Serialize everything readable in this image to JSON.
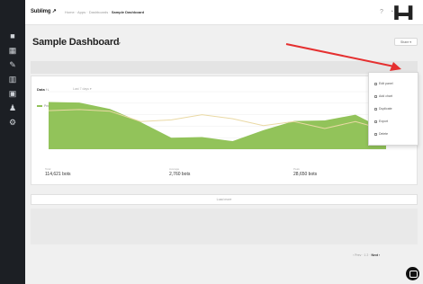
{
  "app": {
    "logo": "Sublimg ↗"
  },
  "breadcrumb": {
    "items": [
      "Home",
      "Apps",
      "Dashboards"
    ],
    "current": "Sample Dashboard"
  },
  "header": {
    "title": "Sample Dashboard",
    "share_label": "Share ▾"
  },
  "panel": {
    "title": "Data ↑↓",
    "subtitle": "Last 7 days ▾",
    "legend": [
      "Primary",
      "Comparison"
    ],
    "stats": [
      {
        "label": "Total",
        "value": "114,621 bots"
      },
      {
        "label": "Average",
        "value": "2,760 bots"
      },
      {
        "label": "Peak",
        "value": "28,650 bots"
      }
    ]
  },
  "load_more_label": "Load more",
  "dropdown": {
    "items": [
      "Edit panel",
      "Add chart",
      "Duplicate",
      "Export",
      "Delete"
    ]
  },
  "pager": {
    "prev": "‹ Prev",
    "pages": "1 2",
    "next": "Next ›"
  },
  "colors": {
    "primary": "#92c35a",
    "comparison": "#ead9a4",
    "sidebar": "#1c1f24",
    "arrow": "#e53030"
  },
  "chart_data": {
    "type": "area",
    "categories": [
      "",
      "",
      "",
      "",
      "",
      "",
      "",
      "",
      "",
      "",
      "",
      ""
    ],
    "series": [
      {
        "name": "Primary",
        "values": [
          8.2,
          8.1,
          7.0,
          4.7,
          2.0,
          2.1,
          1.4,
          3.3,
          4.9,
          5.0,
          6.0,
          3.3
        ]
      },
      {
        "name": "Comparison",
        "values": [
          6.7,
          6.9,
          6.6,
          4.8,
          5.1,
          6.0,
          5.3,
          4.1,
          4.8,
          3.6,
          4.8,
          3.3
        ]
      }
    ],
    "ylim": [
      0,
      10
    ],
    "grid": true,
    "legend": "top-left"
  }
}
